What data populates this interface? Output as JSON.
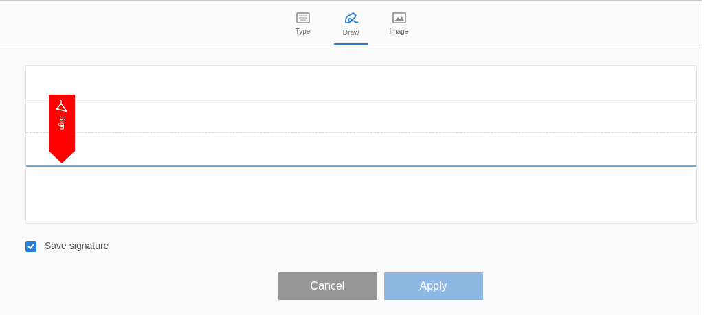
{
  "tabs": [
    {
      "kind": "type",
      "label": "Type",
      "selected": false
    },
    {
      "kind": "draw",
      "label": "Draw",
      "selected": true
    },
    {
      "kind": "image",
      "label": "Image",
      "selected": false
    }
  ],
  "signature_pad": {
    "marker_label": "Sign"
  },
  "save_signature": {
    "label": "Save signature",
    "checked": true
  },
  "buttons": [
    {
      "kind": "cancel",
      "label": "Cancel",
      "disabled": false
    },
    {
      "kind": "apply",
      "label": "Apply",
      "disabled": true
    }
  ]
}
